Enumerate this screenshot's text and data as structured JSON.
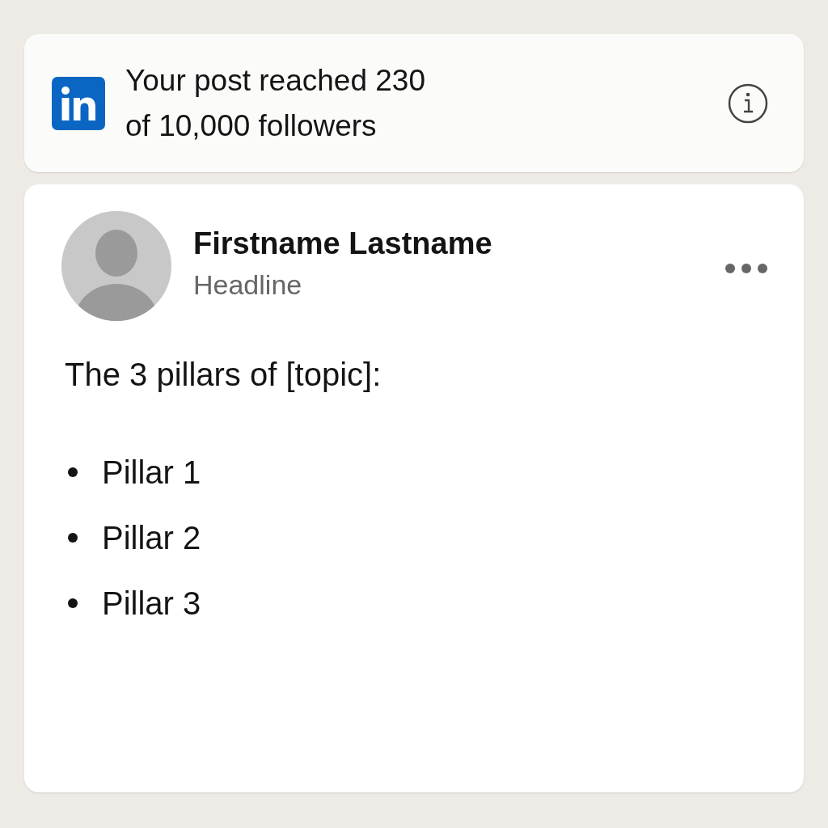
{
  "notification": {
    "message": "Your post reached 230\nof 10,000 followers"
  },
  "post": {
    "author": {
      "name": "Firstname Lastname",
      "headline": "Headline"
    },
    "text": "The 3 pillars of [topic]:",
    "bullets": [
      "Pillar 1",
      "Pillar 2",
      "Pillar 3"
    ]
  }
}
